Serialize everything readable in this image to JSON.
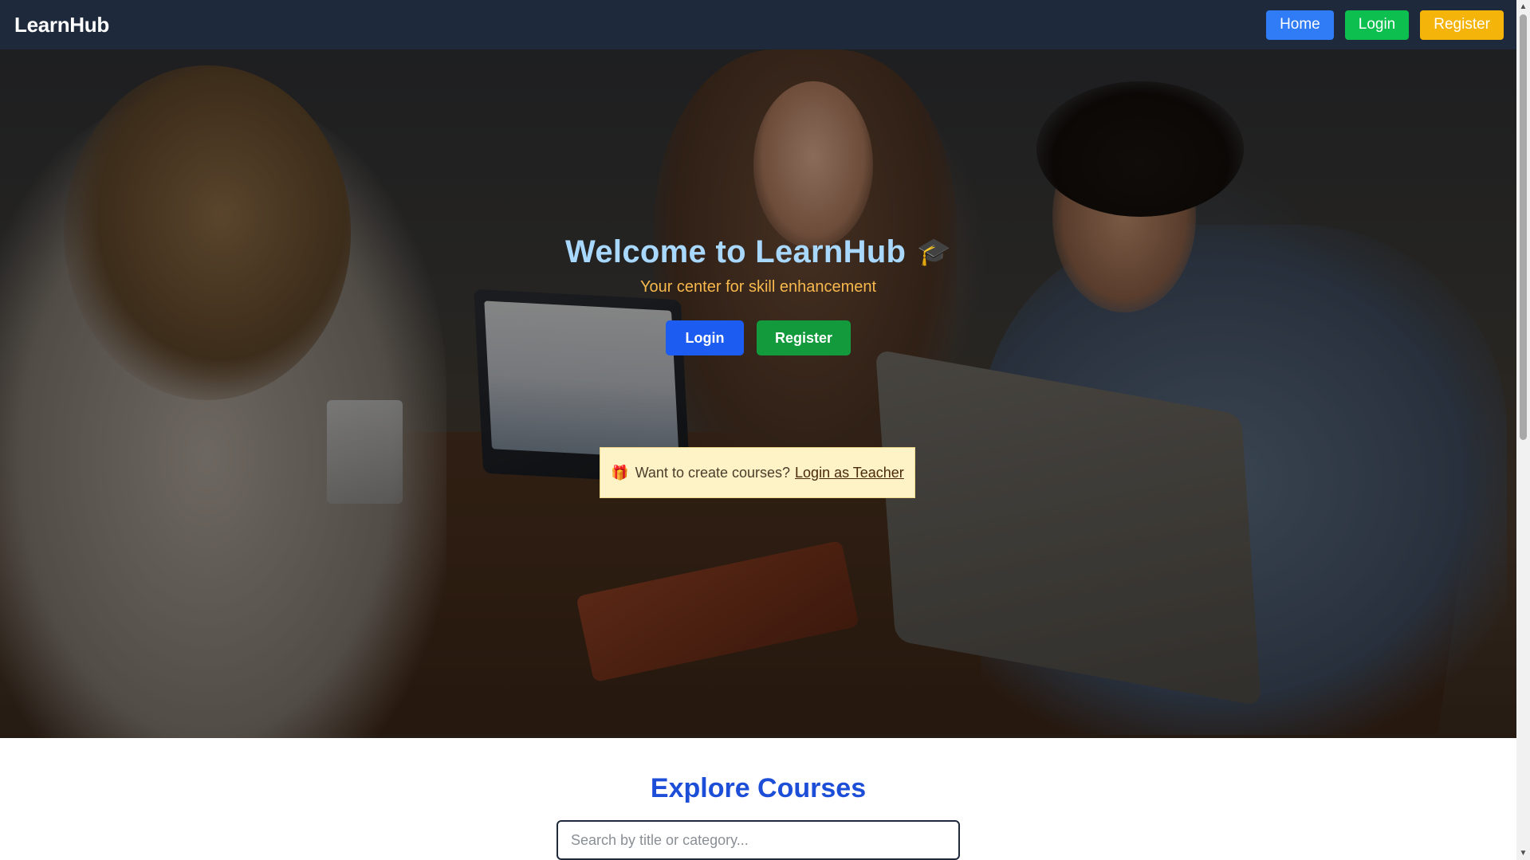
{
  "navbar": {
    "brand": "LearnHub",
    "buttons": {
      "home": "Home",
      "login": "Login",
      "register": "Register"
    }
  },
  "hero": {
    "title": "Welcome to LearnHub",
    "title_emoji": "🎓",
    "subtitle": "Your center for skill enhancement",
    "buttons": {
      "login": "Login",
      "register": "Register"
    },
    "teacher_prompt": {
      "emoji": "🎁",
      "text": "Want to create courses?",
      "link": "Login as Teacher"
    }
  },
  "explore": {
    "title": "Explore Courses",
    "search_placeholder": "Search by title or category..."
  },
  "colors": {
    "navbar_bg": "#1e293b",
    "home_btn": "#2f7cf6",
    "login_btn": "#0cbf4f",
    "register_btn": "#f4b40a",
    "hero_title": "#a9d8ff",
    "hero_subtitle": "#f7b84d",
    "explore_title": "#1d4ed8",
    "teacher_box_bg": "#fef3c7"
  },
  "icons": {
    "graduation_cap": "graduation-cap-icon",
    "gift": "gift-icon",
    "scroll_up": "scroll-up-arrow-icon",
    "scroll_down": "scroll-down-arrow-icon"
  }
}
